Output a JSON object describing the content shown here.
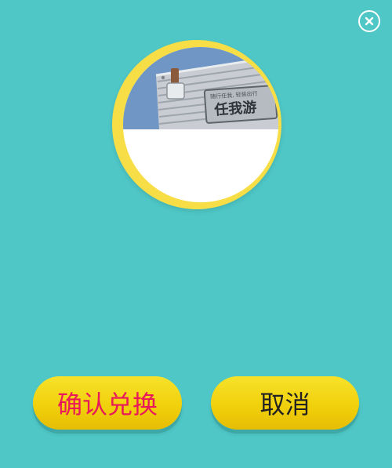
{
  "dialog": {
    "close_icon": "close-icon",
    "product": {
      "image_alt": "suitcase-image",
      "brand_text": "任我游",
      "tag_text": "随行任我, 轻装出行"
    },
    "buttons": {
      "confirm_label": "确认兑换",
      "cancel_label": "取消"
    }
  },
  "colors": {
    "background": "#4EC7C6",
    "ring": "#F7DE47",
    "button": "#F2D20F",
    "confirm_text": "#E8185A",
    "cancel_text": "#222222"
  }
}
